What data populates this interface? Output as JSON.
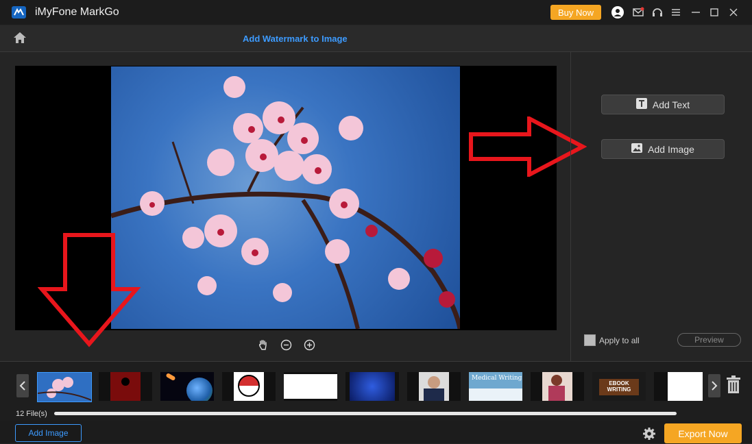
{
  "app": {
    "title": "iMyFone MarkGo",
    "buy_label": "Buy Now"
  },
  "toolbar": {
    "page_title": "Add Watermark to Image"
  },
  "side": {
    "add_text_label": "Add Text",
    "add_image_label": "Add Image",
    "apply_all_label": "Apply to all",
    "preview_label": "Preview"
  },
  "strip": {
    "files_label": "12 File(s)",
    "thumbs": [
      "",
      "",
      "",
      "",
      "",
      "",
      "",
      "Medical Writing",
      "",
      "EBOOK WRITING",
      ""
    ]
  },
  "footer": {
    "add_image_label": "Add Image",
    "export_label": "Export Now"
  },
  "colors": {
    "accent": "#3d9bff",
    "buy": "#f5a623",
    "annotation": "#e8161c"
  },
  "icons": [
    "logo-icon",
    "user-icon",
    "mail-icon",
    "headset-icon",
    "menu-icon",
    "minimize-icon",
    "maximize-icon",
    "close-icon",
    "home-icon",
    "hand-icon",
    "zoom-out-icon",
    "zoom-in-icon",
    "text-icon",
    "image-icon",
    "chevron-left-icon",
    "chevron-right-icon",
    "trash-icon",
    "gear-icon"
  ]
}
